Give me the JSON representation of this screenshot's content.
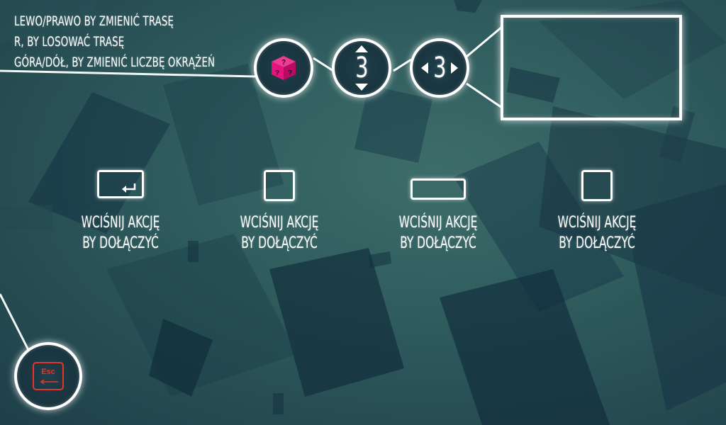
{
  "instructions": [
    "LEWO/PRAWO BY ZMIENIĆ TRASĘ",
    "R, BY LOSOWAĆ TRASĘ",
    "GÓRA/DÓŁ, BY ZMIENIĆ LICZBĘ OKRĄŻEŃ"
  ],
  "controls": {
    "random_icon": "dice-icon",
    "laps_value": "3",
    "track_value": "3"
  },
  "players": [
    {
      "key": "enter-key-icon",
      "line1": "WCIŚNIJ AKCJĘ",
      "line2": "BY DOŁĄCZYĆ"
    },
    {
      "key": "square-key-icon",
      "line1": "WCIŚNIJ AKCJĘ",
      "line2": "BY DOŁĄCZYĆ"
    },
    {
      "key": "space-key-icon",
      "line1": "WCIŚNIJ AKCJĘ",
      "line2": "BY DOŁĄCZYĆ"
    },
    {
      "key": "square-key-icon",
      "line1": "WCIŚNIJ AKCJĘ",
      "line2": "BY DOŁĄCZYĆ"
    }
  ],
  "esc": {
    "label": "Esc",
    "icon": "back-arrow-icon"
  },
  "colors": {
    "accent_red": "#e8332c",
    "dice_pink": "#e6127e",
    "glow": "#ffffff"
  }
}
